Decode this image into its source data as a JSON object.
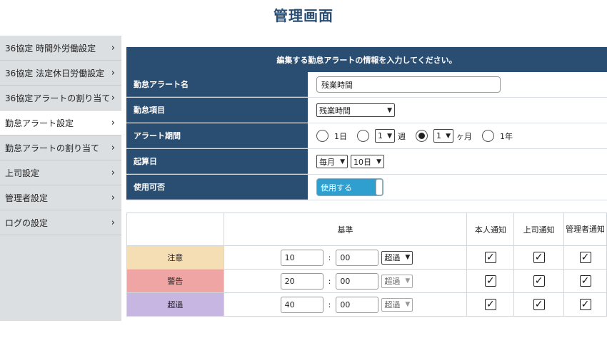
{
  "page": {
    "title": "管理画面"
  },
  "sidebar": {
    "items": [
      {
        "label": "36協定 時間外労働設定"
      },
      {
        "label": "36協定 法定休日労働設定"
      },
      {
        "label": "36協定アラートの割り当て"
      },
      {
        "label": "勤怠アラート設定",
        "active": true
      },
      {
        "label": "勤怠アラートの割り当て"
      },
      {
        "label": "上司設定"
      },
      {
        "label": "管理者設定"
      },
      {
        "label": "ログの設定"
      }
    ]
  },
  "form": {
    "header": "編集する勤怠アラートの情報を入力してください。",
    "name_label": "勤怠アラート名",
    "name_value": "残業時間",
    "item_label": "勤怠項目",
    "item_value": "残業時間",
    "period_label": "アラート期間",
    "period": {
      "day": "1日",
      "week_count": "1",
      "week_unit": "週",
      "month_count": "1",
      "month_unit": "ヶ月",
      "year": "1年",
      "selected": "month"
    },
    "start_label": "起算日",
    "start_cycle": "毎月",
    "start_day": "10日",
    "enable_label": "使用可否",
    "enable_value": "使用する"
  },
  "thresholds": {
    "headers": {
      "criteria": "基準",
      "self": "本人通知",
      "boss": "上司通知",
      "admin": "管理者通知"
    },
    "separator": ":",
    "rows": [
      {
        "level": "注意",
        "color": "#f6deb4",
        "hours": "10",
        "minutes": "00",
        "mode": "超過",
        "mode_enabled": true,
        "self": true,
        "boss": true,
        "admin": true
      },
      {
        "level": "警告",
        "color": "#eea5a4",
        "hours": "20",
        "minutes": "00",
        "mode": "超過",
        "mode_enabled": false,
        "self": true,
        "boss": true,
        "admin": true
      },
      {
        "level": "超過",
        "color": "#c8b6e2",
        "hours": "40",
        "minutes": "00",
        "mode": "超過",
        "mode_enabled": false,
        "self": true,
        "boss": true,
        "admin": true
      }
    ]
  }
}
